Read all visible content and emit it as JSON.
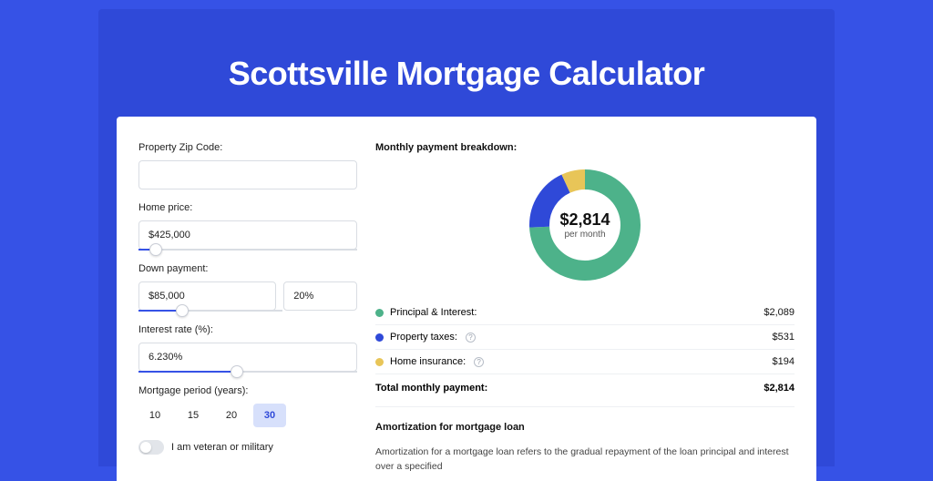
{
  "title": "Scottsville Mortgage Calculator",
  "form": {
    "zip_label": "Property Zip Code:",
    "zip_value": "",
    "home_price_label": "Home price:",
    "home_price_value": "$425,000",
    "home_price_slider_pct": 8,
    "down_payment_label": "Down payment:",
    "down_payment_value": "$85,000",
    "down_payment_pct_value": "20%",
    "down_payment_slider_pct": 30,
    "interest_label": "Interest rate (%):",
    "interest_value": "6.230%",
    "interest_slider_pct": 45,
    "period_label": "Mortgage period (years):",
    "periods": [
      "10",
      "15",
      "20",
      "30"
    ],
    "period_active_index": 3,
    "veteran_label": "I am veteran or military"
  },
  "breakdown": {
    "heading": "Monthly payment breakdown:",
    "total_amount": "$2,814",
    "per_month": "per month",
    "items": [
      {
        "label": "Principal & Interest:",
        "value": "$2,089"
      },
      {
        "label": "Property taxes:",
        "value": "$531"
      },
      {
        "label": "Home insurance:",
        "value": "$194"
      }
    ],
    "total_label": "Total monthly payment:",
    "total_value": "$2,814"
  },
  "amort": {
    "heading": "Amortization for mortgage loan",
    "text": "Amortization for a mortgage loan refers to the gradual repayment of the loan principal and interest over a specified"
  },
  "chart_data": {
    "type": "pie",
    "title": "Monthly payment breakdown",
    "series": [
      {
        "name": "Principal & Interest",
        "value": 2089,
        "color": "#4db28a"
      },
      {
        "name": "Property taxes",
        "value": 531,
        "color": "#2f49d8"
      },
      {
        "name": "Home insurance",
        "value": 194,
        "color": "#e8c558"
      }
    ],
    "total": 2814,
    "unit": "USD/month"
  }
}
